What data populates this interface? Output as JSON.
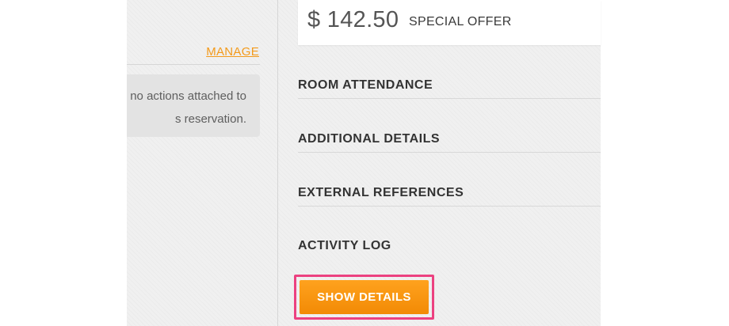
{
  "left_panel": {
    "manage_link": "MANAGE",
    "notice_line_1": "no actions attached to",
    "notice_line_2": "s reservation."
  },
  "price_card": {
    "amount": "$ 142.50",
    "label": "SPECIAL OFFER"
  },
  "sections": [
    {
      "title": "ROOM ATTENDANCE"
    },
    {
      "title": "ADDITIONAL DETAILS"
    },
    {
      "title": "EXTERNAL REFERENCES"
    },
    {
      "title": "ACTIVITY LOG"
    }
  ],
  "actions": {
    "show_details_label": "SHOW DETAILS"
  },
  "colors": {
    "accent": "#f39a1b",
    "highlight_border": "#ec4180",
    "button_top": "#ffa21e",
    "button_bottom": "#f28a05"
  }
}
